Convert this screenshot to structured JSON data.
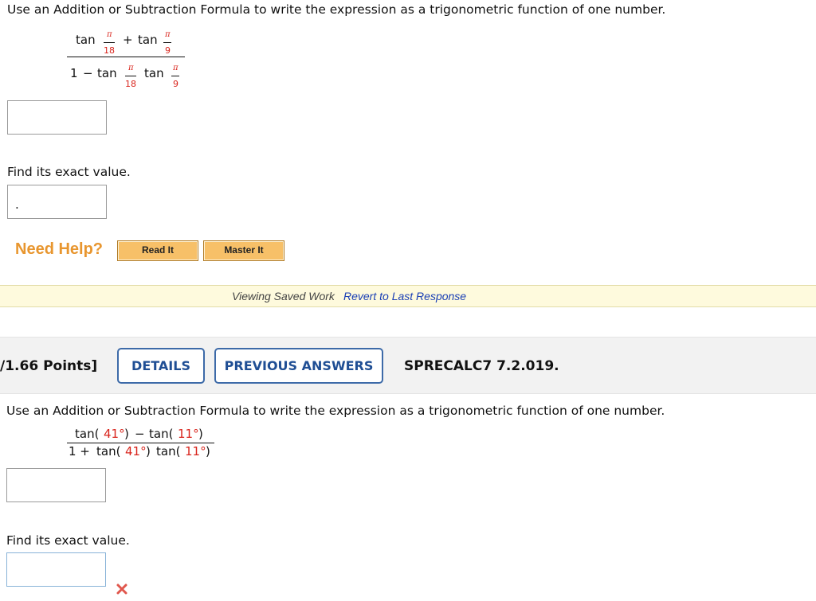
{
  "q1": {
    "prompt": "Use an Addition or Subtraction Formula to write the expression as a trigonometric function of one number.",
    "tan": "tan",
    "plus": "+",
    "minus": "−",
    "one": "1",
    "pi": "π",
    "den_a": "18",
    "den_b": "9",
    "find_label": "Find its exact value.",
    "answer2_value": "."
  },
  "help": {
    "label": "Need Help?",
    "read_it": "Read It",
    "master_it": "Master It"
  },
  "saved_bar": {
    "text": "Viewing Saved Work",
    "link": "Revert to Last Response"
  },
  "q2_header": {
    "points": "/1.66 Points]",
    "details": "DETAILS",
    "previous_answers": "PREVIOUS ANSWERS",
    "code": "SPRECALC7 7.2.019."
  },
  "q2": {
    "prompt": "Use an Addition or Subtraction Formula to write the expression as a trigonometric function of one number.",
    "tan": "tan(",
    "angle_a": "41°",
    "angle_b": "11°",
    "close": ")",
    "minus": "−",
    "one_plus": "1 +",
    "find_label": "Find its exact value."
  },
  "icons": {
    "incorrect": "incorrect-x-icon"
  },
  "colors": {
    "accent_red": "#d9251d",
    "pill_blue": "#1f4e94",
    "help_orange": "#e8962f"
  }
}
